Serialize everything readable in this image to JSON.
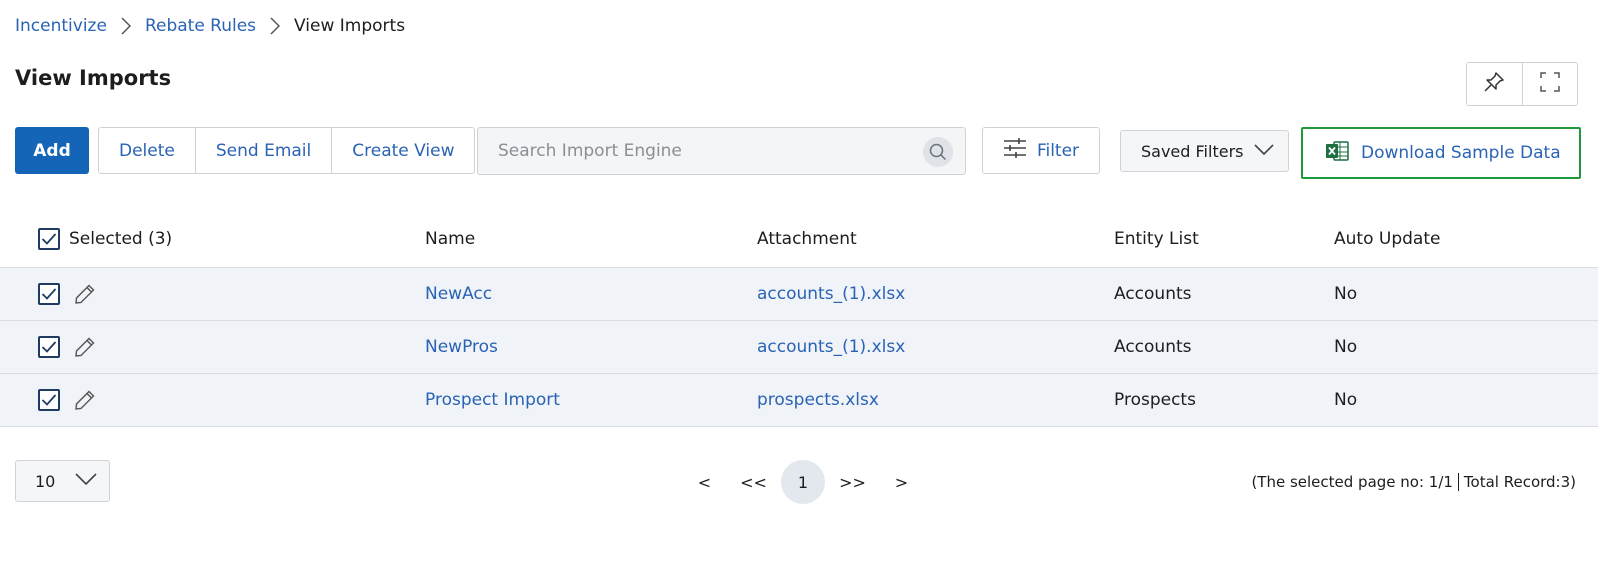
{
  "breadcrumb": {
    "items": [
      {
        "label": "Incentivize"
      },
      {
        "label": "Rebate Rules"
      }
    ],
    "current": "View Imports"
  },
  "page": {
    "title": "View Imports"
  },
  "toolbar": {
    "add_label": "Add",
    "delete_label": "Delete",
    "send_email_label": "Send Email",
    "create_view_label": "Create View",
    "search_placeholder": "Search Import Engine",
    "filter_label": "Filter",
    "saved_filters_label": "Saved Filters",
    "download_label": "Download Sample Data"
  },
  "table": {
    "selected_label": "Selected (3)",
    "columns": {
      "name": "Name",
      "attachment": "Attachment",
      "entity": "Entity List",
      "auto_update": "Auto Update"
    },
    "rows": [
      {
        "name": "NewAcc",
        "attachment": "accounts_(1).xlsx",
        "entity": "Accounts",
        "auto_update": "No",
        "checked": true
      },
      {
        "name": "NewPros",
        "attachment": "accounts_(1).xlsx",
        "entity": "Accounts",
        "auto_update": "No",
        "checked": true
      },
      {
        "name": "Prospect Import",
        "attachment": "prospects.xlsx",
        "entity": "Prospects",
        "auto_update": "No",
        "checked": true
      }
    ]
  },
  "footer": {
    "page_size": "10",
    "pager": {
      "first": "<",
      "prev": "<<",
      "current": "1",
      "next": ">>",
      "last": ">"
    },
    "page_info_left": "(The selected page no: 1/1",
    "page_info_right": "Total Record:3)"
  },
  "colors": {
    "primary": "#1464b8",
    "link": "#2a63b5",
    "highlight_border": "#1f9a3a",
    "row_bg": "#f0f3f7",
    "excel_green": "#1d6f42"
  },
  "icons": {
    "breadcrumb_separator": "chevron-right-icon",
    "pin": "pin-icon",
    "fullscreen": "fullscreen-icon",
    "search": "search-icon",
    "filter": "sliders-icon",
    "dropdown": "chevron-down-icon",
    "excel": "excel-icon",
    "checkbox": "checkbox-checked-icon",
    "edit": "pencil-icon"
  }
}
